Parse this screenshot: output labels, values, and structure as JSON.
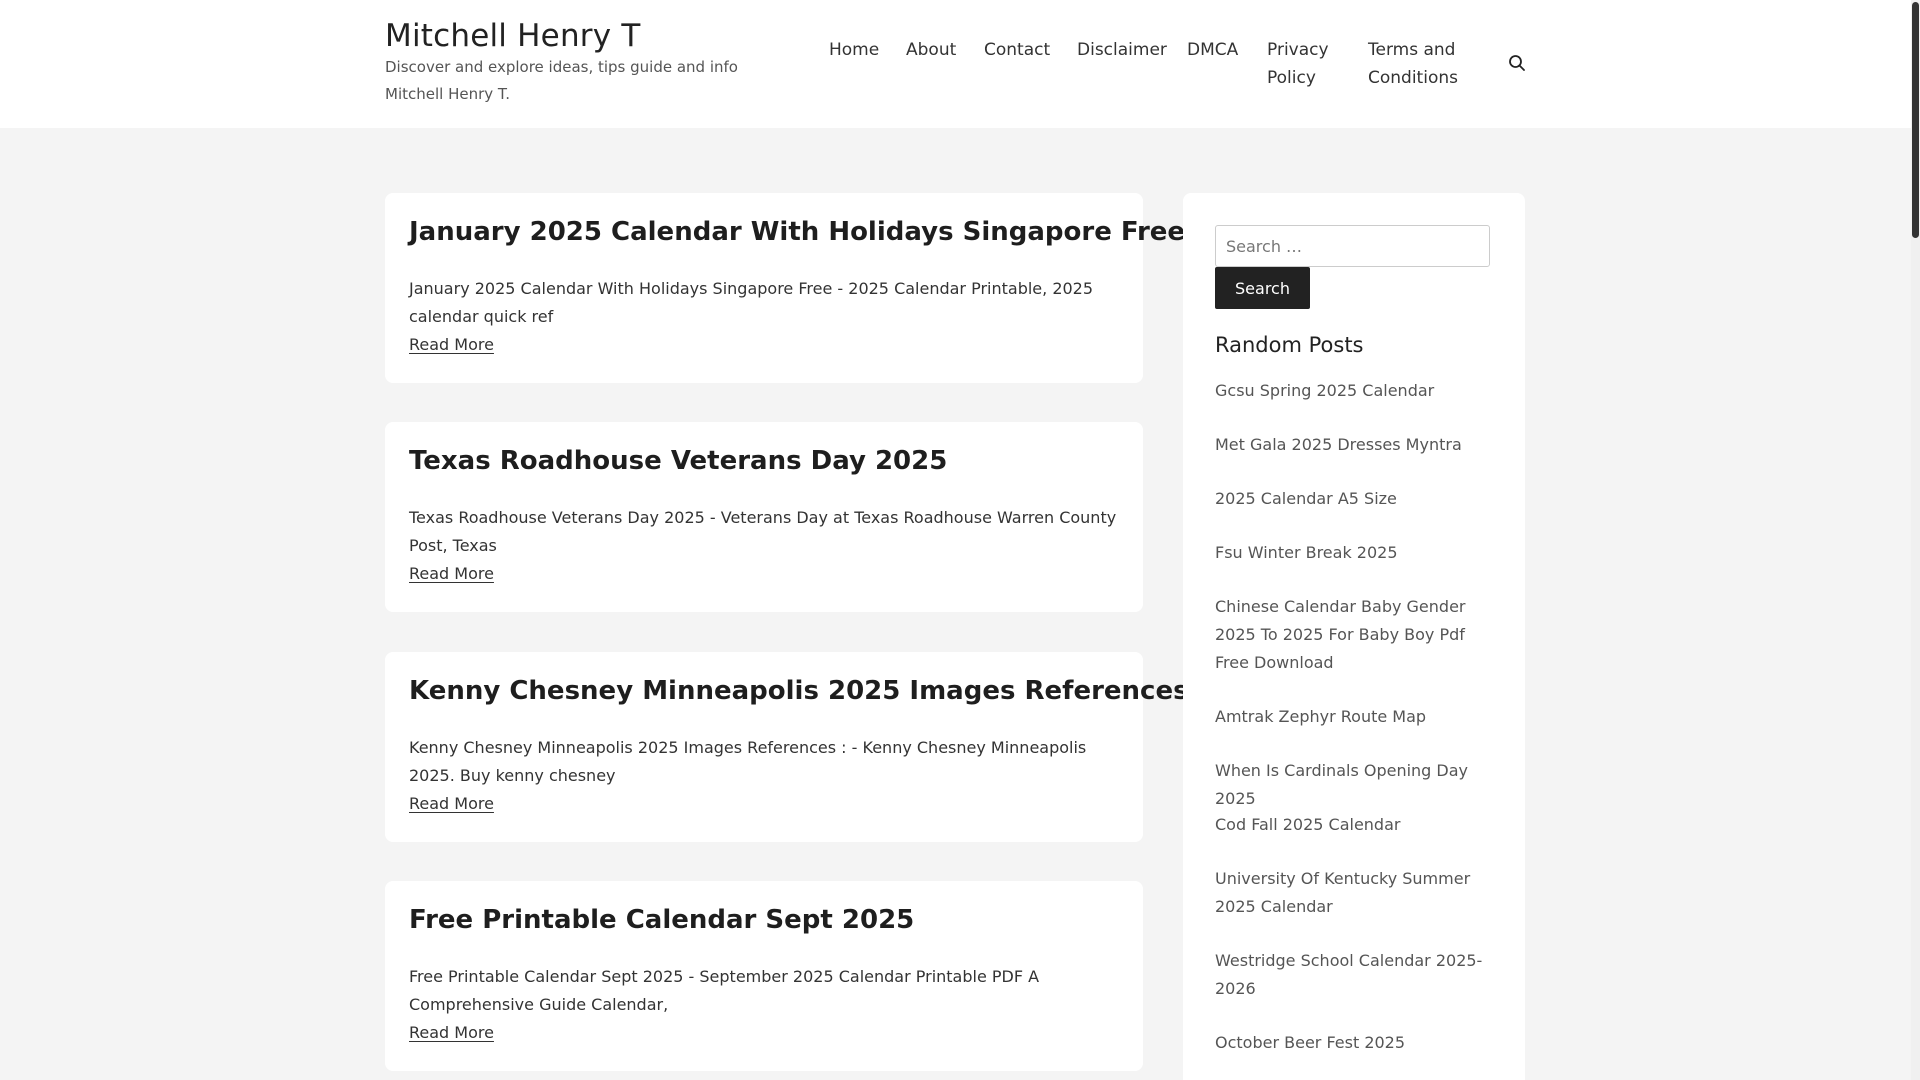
{
  "site": {
    "title": "Mitchell Henry T",
    "description": "Discover and explore ideas, tips guide and info Mitchell Henry T."
  },
  "nav": {
    "items": [
      {
        "label": "Home"
      },
      {
        "label": "About"
      },
      {
        "label": "Contact"
      },
      {
        "label": "Disclaimer"
      },
      {
        "label": "DMCA"
      },
      {
        "label": "Privacy Policy"
      },
      {
        "label": "Terms and Conditions"
      }
    ],
    "search_icon": "search-icon"
  },
  "posts": [
    {
      "title": "January 2025 Calendar With Holidays Singapore Free",
      "excerpt": "January 2025 Calendar With Holidays Singapore Free - 2025 Calendar Printable, 2025 calendar quick ref",
      "more": "Read More"
    },
    {
      "title": "Texas Roadhouse Veterans Day 2025",
      "excerpt": "Texas Roadhouse Veterans Day 2025 - Veterans Day at Texas Roadhouse Warren County Post, Texas",
      "more": "Read More"
    },
    {
      "title": "Kenny Chesney Minneapolis 2025 Images References :",
      "excerpt": "Kenny Chesney Minneapolis 2025 Images References : - Kenny Chesney Minneapolis 2025. Buy kenny chesney",
      "more": "Read More"
    },
    {
      "title": "Free Printable Calendar Sept 2025",
      "excerpt": "Free Printable Calendar Sept 2025 - September 2025 Calendar Printable PDF A Comprehensive Guide Calendar,",
      "more": "Read More"
    }
  ],
  "sidebar": {
    "search_placeholder": "Search …",
    "search_button": "Search",
    "random_heading": "Random Posts",
    "random_posts": [
      "Gcsu Spring 2025 Calendar",
      "Met Gala 2025 Dresses Myntra",
      "2025 Calendar A5 Size",
      "Fsu Winter Break 2025",
      "Chinese Calendar Baby Gender 2025 To 2025 For Baby Boy Pdf Free Download",
      "Amtrak Zephyr Route Map",
      "When Is Cardinals Opening Day 2025",
      "Cod Fall 2025 Calendar",
      "University Of Kentucky Summer 2025 Calendar",
      "Westridge School Calendar 2025-2026",
      "October Beer Fest 2025"
    ]
  }
}
